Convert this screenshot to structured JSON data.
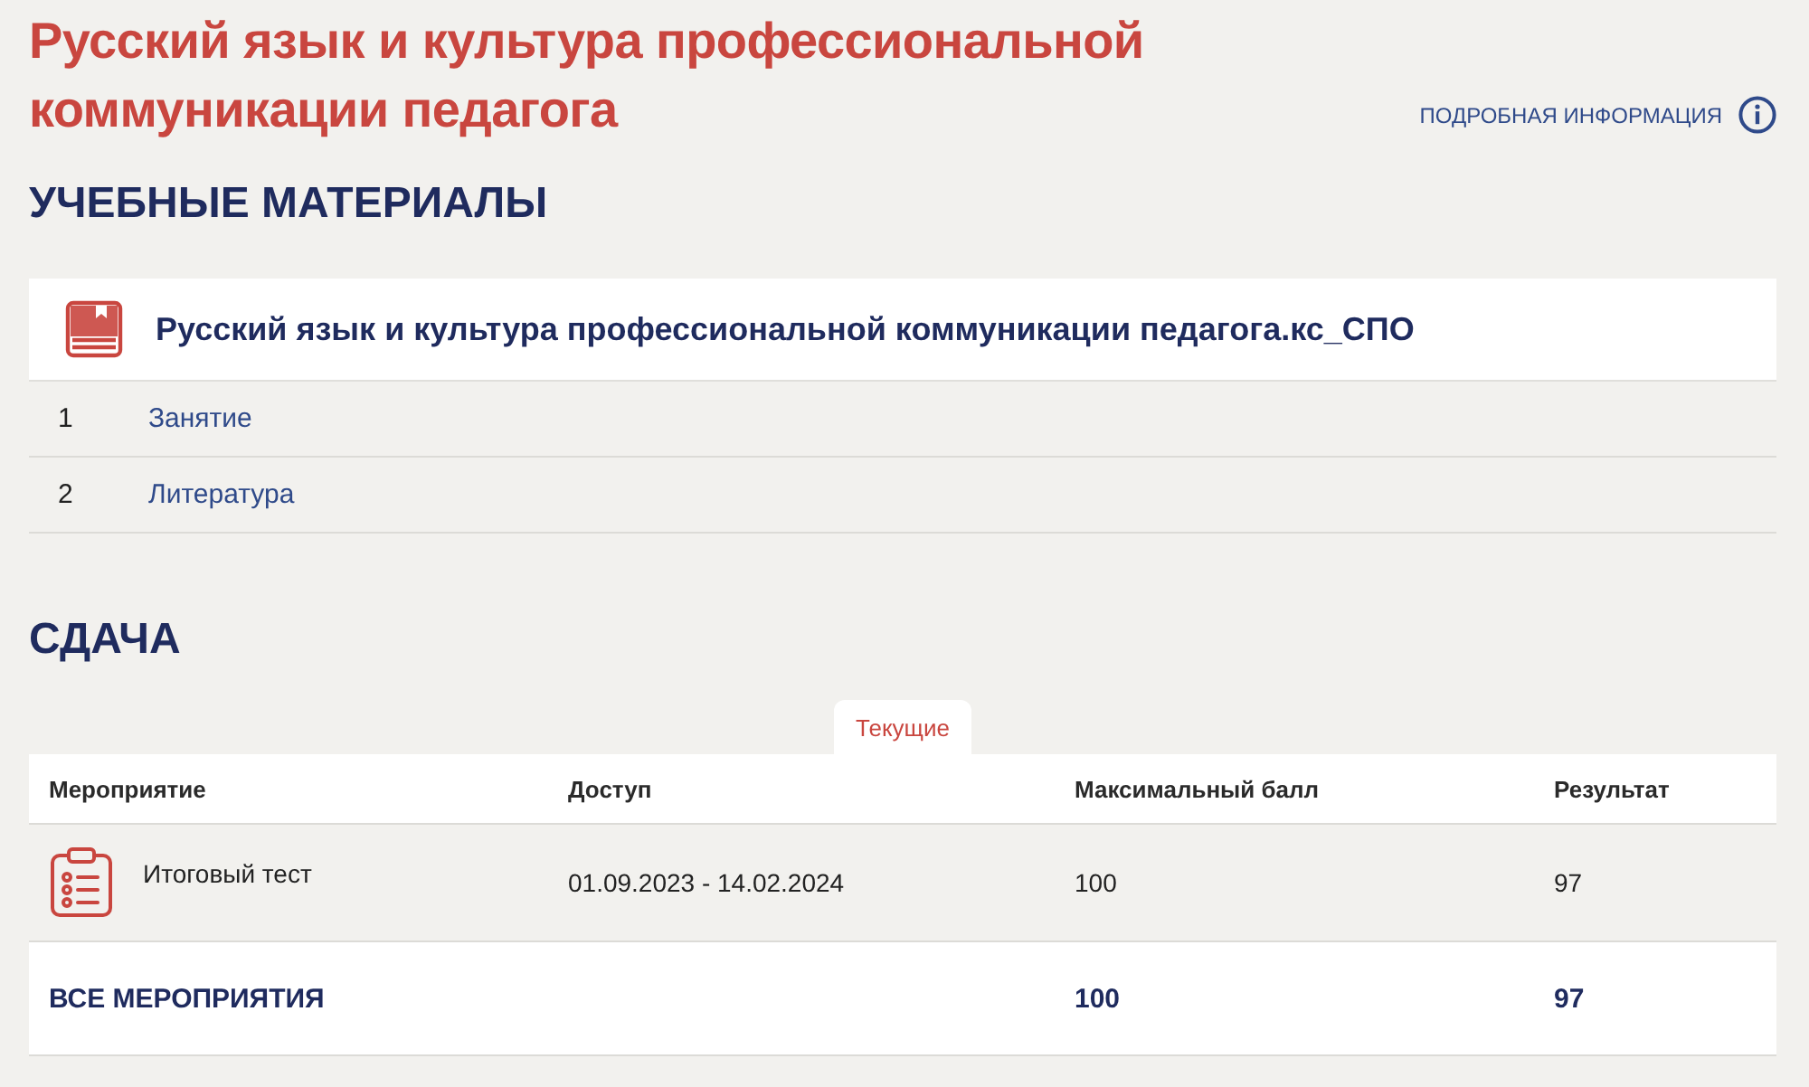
{
  "course_title": "Русский язык и культура профессиональной коммуникации педагога",
  "details_link": "ПОДРОБНАЯ ИНФОРМАЦИЯ",
  "materials": {
    "heading": "УЧЕБНЫЕ МАТЕРИАЛЫ",
    "resource_title": "Русский язык и культура профессиональной коммуникации педагога.кс_СПО",
    "items": [
      {
        "number": "1",
        "title": "Занятие"
      },
      {
        "number": "2",
        "title": "Литература"
      }
    ]
  },
  "submission": {
    "heading": "СДАЧА",
    "tabs": [
      {
        "label": "Текущие",
        "selected": true
      }
    ],
    "table": {
      "columns": [
        "Мероприятие",
        "Доступ",
        "Максимальный балл",
        "Результат"
      ],
      "rows": [
        {
          "event": "Итоговый тест",
          "access": "01.09.2023 - 14.02.2024",
          "max_score": "100",
          "result": "97"
        }
      ],
      "total": {
        "label": "ВСЕ МЕРОПРИЯТИЯ",
        "max_score": "100",
        "result": "97"
      }
    }
  }
}
